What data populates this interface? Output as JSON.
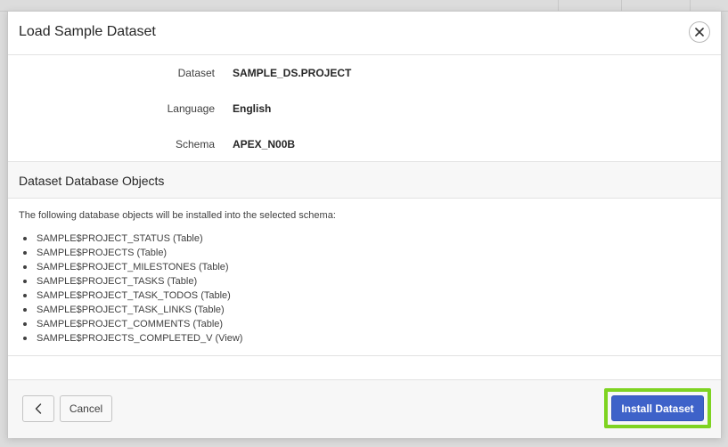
{
  "dialog": {
    "title": "Load Sample Dataset",
    "close_icon": "close-icon"
  },
  "form": {
    "fields": [
      {
        "label": "Dataset",
        "value": "SAMPLE_DS.PROJECT"
      },
      {
        "label": "Language",
        "value": "English"
      },
      {
        "label": "Schema",
        "value": "APEX_N00B"
      }
    ]
  },
  "objects_section": {
    "title": "Dataset Database Objects",
    "intro": "The following database objects will be installed into the selected schema:",
    "items": [
      "SAMPLE$PROJECT_STATUS (Table)",
      "SAMPLE$PROJECTS (Table)",
      "SAMPLE$PROJECT_MILESTONES (Table)",
      "SAMPLE$PROJECT_TASKS (Table)",
      "SAMPLE$PROJECT_TASK_TODOS (Table)",
      "SAMPLE$PROJECT_TASK_LINKS (Table)",
      "SAMPLE$PROJECT_COMMENTS (Table)",
      "SAMPLE$PROJECTS_COMPLETED_V (View)"
    ]
  },
  "footer": {
    "back_icon": "chevron-left-icon",
    "cancel_label": "Cancel",
    "install_label": "Install Dataset",
    "highlight_color": "#7ed321",
    "primary_color": "#3e62c9"
  }
}
